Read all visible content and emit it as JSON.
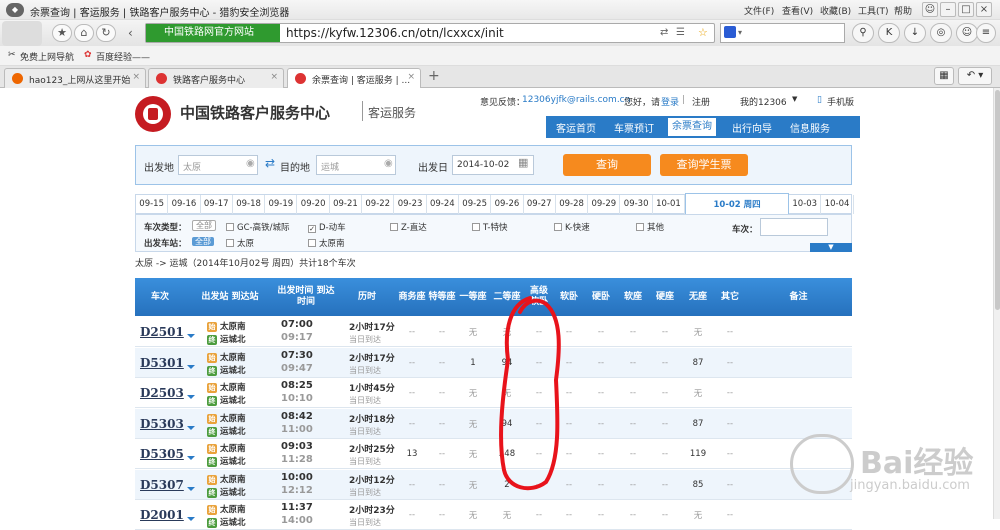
{
  "browser": {
    "title": "余票查询 | 客运服务 | 铁路客户服务中心 - 猎豹安全浏览器",
    "menu": [
      "文件(F)",
      "查看(V)",
      "收藏(B)",
      "工具(T)",
      "帮助"
    ],
    "site_badge": "中国铁路网官方网站",
    "url": "https://kyfw.12306.cn/otn/lcxxcx/init",
    "bookmarks": [
      "免费上网导航",
      "百度经验——"
    ],
    "tabs": [
      {
        "label": "hao123_上网从这里开始"
      },
      {
        "label": "铁路客户服务中心"
      },
      {
        "label": "余票查询 | 客运服务 | ..."
      }
    ]
  },
  "header": {
    "site_name": "中国铁路客户服务中心",
    "site_sub": "客运服务",
    "feedback_label": "意见反馈：",
    "feedback_email": "12306yjfk@rails.com.cn",
    "greeting": "您好，请",
    "login": "登录",
    "register": "注册",
    "my12306": "我的12306",
    "mobile": "手机版",
    "nav": [
      "客运首页",
      "车票预订",
      "余票查询",
      "出行向导",
      "信息服务"
    ]
  },
  "query": {
    "from_label": "出发地",
    "from_value": "太原",
    "to_label": "目的地",
    "to_value": "运城",
    "date_label": "出发日",
    "date_value": "2014-10-02",
    "search_button": "查询",
    "student_button": "查询学生票"
  },
  "dates": [
    "09-15",
    "09-16",
    "09-17",
    "09-18",
    "09-19",
    "09-20",
    "09-21",
    "09-22",
    "09-23",
    "09-24",
    "09-25",
    "09-26",
    "09-27",
    "09-28",
    "09-29",
    "09-30",
    "10-01",
    "10-02 周四",
    "10-03",
    "10-04"
  ],
  "filters": {
    "type_label": "车次类型：",
    "station_label": "出发车站：",
    "all": "全部",
    "types": [
      {
        "label": "GC-高铁/城际",
        "checked": false
      },
      {
        "label": "D-动车",
        "checked": true
      },
      {
        "label": "Z-直达",
        "checked": false
      },
      {
        "label": "T-特快",
        "checked": false
      },
      {
        "label": "K-快速",
        "checked": false
      },
      {
        "label": "其他",
        "checked": false
      }
    ],
    "stations": [
      "太原",
      "太原南"
    ],
    "train_no_label": "车次："
  },
  "summary": "太原 -> 运城（2014年10月02号  周四）共计18个车次",
  "table": {
    "headers": [
      "车次",
      "出发站 到达站",
      "出发时间 到达时间",
      "历时",
      "商务座",
      "特等座",
      "一等座",
      "二等座",
      "高级 软卧",
      "软卧",
      "硬卧",
      "软座",
      "硬座",
      "无座",
      "其它",
      "备注"
    ],
    "rows": [
      {
        "train": "D2501",
        "from": "太原南",
        "to": "运城北",
        "dep": "07:00",
        "arr": "09:17",
        "dur": "2小时17分",
        "day": "当日到达",
        "seats": [
          "--",
          "--",
          "无",
          "无",
          "--",
          "--",
          "--",
          "--",
          "--",
          "无",
          "--",
          ""
        ]
      },
      {
        "train": "D5301",
        "from": "太原南",
        "to": "运城北",
        "dep": "07:30",
        "arr": "09:47",
        "dur": "2小时17分",
        "day": "当日到达",
        "seats": [
          "--",
          "--",
          "1",
          "94",
          "--",
          "--",
          "--",
          "--",
          "--",
          "87",
          "--",
          ""
        ]
      },
      {
        "train": "D2503",
        "from": "太原南",
        "to": "运城北",
        "dep": "08:25",
        "arr": "10:10",
        "dur": "1小时45分",
        "day": "当日到达",
        "seats": [
          "--",
          "--",
          "无",
          "无",
          "--",
          "--",
          "--",
          "--",
          "--",
          "无",
          "--",
          ""
        ]
      },
      {
        "train": "D5303",
        "from": "太原南",
        "to": "运城北",
        "dep": "08:42",
        "arr": "11:00",
        "dur": "2小时18分",
        "day": "当日到达",
        "seats": [
          "--",
          "--",
          "无",
          "94",
          "--",
          "--",
          "--",
          "--",
          "--",
          "87",
          "--",
          ""
        ]
      },
      {
        "train": "D5305",
        "from": "太原南",
        "to": "运城北",
        "dep": "09:03",
        "arr": "11:28",
        "dur": "2小时25分",
        "day": "当日到达",
        "seats": [
          "13",
          "--",
          "无",
          "248",
          "--",
          "--",
          "--",
          "--",
          "--",
          "119",
          "--",
          ""
        ]
      },
      {
        "train": "D5307",
        "from": "太原南",
        "to": "运城北",
        "dep": "10:00",
        "arr": "12:12",
        "dur": "2小时12分",
        "day": "当日到达",
        "seats": [
          "--",
          "--",
          "无",
          "2",
          "--",
          "--",
          "--",
          "--",
          "--",
          "85",
          "--",
          ""
        ]
      },
      {
        "train": "D2001",
        "from": "太原南",
        "to": "运城北",
        "dep": "11:37",
        "arr": "14:00",
        "dur": "2小时23分",
        "day": "当日到达",
        "seats": [
          "--",
          "--",
          "无",
          "无",
          "--",
          "--",
          "--",
          "--",
          "--",
          "无",
          "--",
          ""
        ]
      }
    ]
  },
  "watermark": {
    "brand": "Bai经验",
    "domain": "jingyan.baidu.com"
  },
  "colors": {
    "accent": "#2a7bc7",
    "orange": "#f68a1e",
    "logo_red": "#c51b21",
    "annotation_red": "#e8131b"
  }
}
